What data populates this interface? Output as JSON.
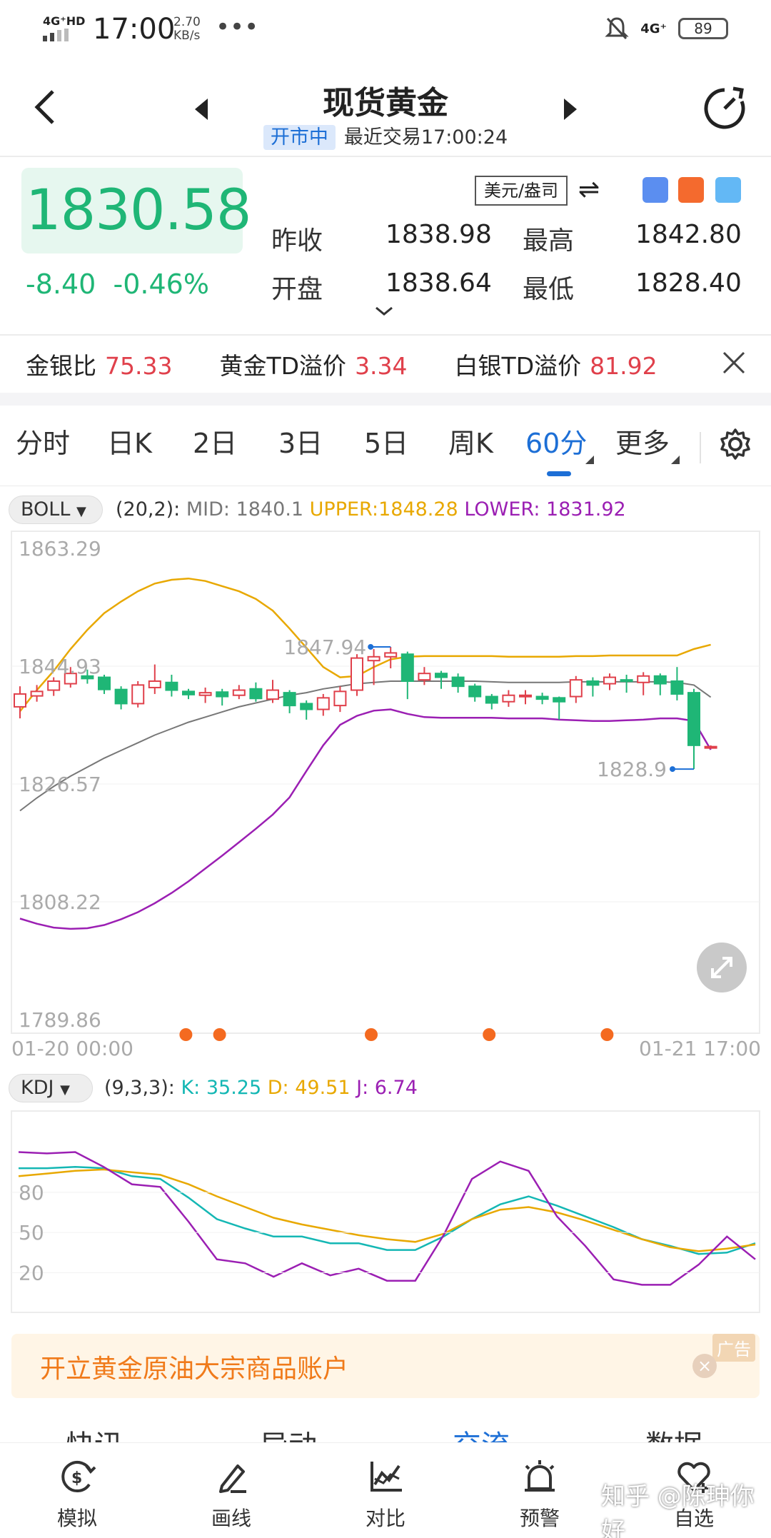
{
  "status_bar": {
    "network": "4G⁺HD",
    "time": "17:00",
    "speed": "2.70",
    "speed_unit": "KB/s",
    "more": "•••",
    "net_right": "4G⁺",
    "battery": "89"
  },
  "header": {
    "title": "现货黄金",
    "market_status": "开市中",
    "last_trade": "最近交易17:00:24"
  },
  "quote": {
    "price": "1830.58",
    "change": "-8.40",
    "change_pct": "-0.46%",
    "unit": "美元/盎司",
    "prev_close_label": "昨收",
    "prev_close": "1838.98",
    "high_label": "最高",
    "high": "1842.80",
    "open_label": "开盘",
    "open": "1838.64",
    "low_label": "最低",
    "low": "1828.40"
  },
  "ratios": [
    {
      "label": "金银比",
      "value": "75.33"
    },
    {
      "label": "黄金TD溢价",
      "value": "3.34"
    },
    {
      "label": "白银TD溢价",
      "value": "81.92"
    }
  ],
  "tabs": [
    "分时",
    "日K",
    "2日",
    "3日",
    "5日",
    "周K",
    "60分",
    "更多"
  ],
  "active_tab": "60分",
  "boll": {
    "name": "BOLL",
    "params": "(20,2):",
    "mid": "MID: 1840.1",
    "upper": "UPPER:1848.28",
    "lower": "LOWER: 1831.92"
  },
  "kdj": {
    "name": "KDJ",
    "params": "(9,3,3):",
    "k": "K: 35.25",
    "d": "D: 49.51",
    "j": "J: 6.74"
  },
  "colors": {
    "up": "#e0404b",
    "down": "#1fb676",
    "accent": "#1d6fd6",
    "upper": "#e8a800",
    "lower": "#9b1fb3",
    "mid": "#777777",
    "k": "#14b7b4"
  },
  "chart_data": [
    {
      "type": "candlestick",
      "title": "",
      "y_ticks": [
        "1863.29",
        "1844.93",
        "1826.57",
        "1808.22",
        "1789.86"
      ],
      "ylim": [
        1789.86,
        1863.29
      ],
      "x_start": "01-20 00:00",
      "x_end": "01-21 17:00",
      "max_marker": "1847.94",
      "min_marker": "1828.9",
      "candles": [
        {
          "o": 1838.6,
          "c": 1840.6,
          "h": 1841.8,
          "l": 1836.8
        },
        {
          "o": 1840.3,
          "c": 1841.0,
          "h": 1842.0,
          "l": 1839.4
        },
        {
          "o": 1841.2,
          "c": 1842.6,
          "h": 1843.2,
          "l": 1840.3
        },
        {
          "o": 1842.2,
          "c": 1843.8,
          "h": 1844.8,
          "l": 1841.6
        },
        {
          "o": 1843.4,
          "c": 1843.0,
          "h": 1844.4,
          "l": 1842.2
        },
        {
          "o": 1843.2,
          "c": 1841.3,
          "h": 1843.6,
          "l": 1840.6
        },
        {
          "o": 1841.3,
          "c": 1839.1,
          "h": 1841.8,
          "l": 1838.2
        },
        {
          "o": 1839.1,
          "c": 1842.0,
          "h": 1842.6,
          "l": 1838.5
        },
        {
          "o": 1841.6,
          "c": 1842.6,
          "h": 1845.2,
          "l": 1840.6
        },
        {
          "o": 1842.4,
          "c": 1841.2,
          "h": 1843.6,
          "l": 1840.2
        },
        {
          "o": 1841.0,
          "c": 1840.5,
          "h": 1841.4,
          "l": 1839.8
        },
        {
          "o": 1840.4,
          "c": 1840.8,
          "h": 1841.6,
          "l": 1839.2
        },
        {
          "o": 1840.9,
          "c": 1840.2,
          "h": 1841.4,
          "l": 1838.8
        },
        {
          "o": 1840.4,
          "c": 1841.2,
          "h": 1842.0,
          "l": 1839.8
        },
        {
          "o": 1841.4,
          "c": 1839.9,
          "h": 1842.4,
          "l": 1839.4
        },
        {
          "o": 1839.8,
          "c": 1841.2,
          "h": 1842.8,
          "l": 1839.2
        },
        {
          "o": 1840.8,
          "c": 1838.8,
          "h": 1841.2,
          "l": 1837.6
        },
        {
          "o": 1839.1,
          "c": 1838.2,
          "h": 1839.6,
          "l": 1836.6
        },
        {
          "o": 1838.2,
          "c": 1840.0,
          "h": 1840.6,
          "l": 1837.2
        },
        {
          "o": 1838.8,
          "c": 1841.0,
          "h": 1841.8,
          "l": 1837.8
        },
        {
          "o": 1841.2,
          "c": 1846.2,
          "h": 1846.8,
          "l": 1840.3
        },
        {
          "o": 1845.8,
          "c": 1846.4,
          "h": 1847.6,
          "l": 1842.0
        },
        {
          "o": 1846.4,
          "c": 1847.0,
          "h": 1847.94,
          "l": 1844.6
        },
        {
          "o": 1846.8,
          "c": 1842.6,
          "h": 1847.2,
          "l": 1839.8
        },
        {
          "o": 1842.8,
          "c": 1843.8,
          "h": 1844.8,
          "l": 1842.0
        },
        {
          "o": 1843.8,
          "c": 1843.2,
          "h": 1844.2,
          "l": 1841.4
        },
        {
          "o": 1843.2,
          "c": 1841.8,
          "h": 1843.8,
          "l": 1840.8
        },
        {
          "o": 1841.8,
          "c": 1840.2,
          "h": 1842.2,
          "l": 1839.4
        },
        {
          "o": 1840.2,
          "c": 1839.2,
          "h": 1840.6,
          "l": 1838.2
        },
        {
          "o": 1839.4,
          "c": 1840.4,
          "h": 1841.2,
          "l": 1838.6
        },
        {
          "o": 1840.2,
          "c": 1840.4,
          "h": 1841.2,
          "l": 1839.0
        },
        {
          "o": 1840.2,
          "c": 1839.8,
          "h": 1840.8,
          "l": 1839.0
        },
        {
          "o": 1840.0,
          "c": 1839.4,
          "h": 1840.2,
          "l": 1836.6
        },
        {
          "o": 1840.2,
          "c": 1842.8,
          "h": 1843.4,
          "l": 1839.2
        },
        {
          "o": 1842.6,
          "c": 1842.0,
          "h": 1843.2,
          "l": 1840.2
        },
        {
          "o": 1842.2,
          "c": 1843.2,
          "h": 1843.8,
          "l": 1841.2
        },
        {
          "o": 1842.8,
          "c": 1842.6,
          "h": 1843.6,
          "l": 1840.8
        },
        {
          "o": 1842.4,
          "c": 1843.4,
          "h": 1844.0,
          "l": 1840.4
        },
        {
          "o": 1843.4,
          "c": 1842.2,
          "h": 1843.8,
          "l": 1840.4
        },
        {
          "o": 1842.6,
          "c": 1840.6,
          "h": 1844.8,
          "l": 1839.6
        },
        {
          "o": 1840.8,
          "c": 1832.6,
          "h": 1841.4,
          "l": 1828.9
        },
        {
          "o": 1832.4,
          "c": 1832.4,
          "h": 1832.6,
          "l": 1832.2
        }
      ],
      "upper": [
        1837.9,
        1841.2,
        1844.2,
        1847.6,
        1850.6,
        1853.2,
        1855.0,
        1856.6,
        1857.8,
        1858.4,
        1858.6,
        1858.2,
        1857.4,
        1856.6,
        1855.4,
        1853.6,
        1850.8,
        1847.8,
        1844.8,
        1843.2,
        1843.4,
        1844.8,
        1846.0,
        1846.4,
        1846.5,
        1846.5,
        1846.5,
        1846.5,
        1846.5,
        1846.4,
        1846.4,
        1846.4,
        1846.4,
        1846.5,
        1846.5,
        1846.6,
        1846.6,
        1846.6,
        1846.6,
        1846.6,
        1847.6,
        1848.28
      ],
      "mid": [
        1822.4,
        1824.4,
        1826.2,
        1827.8,
        1829.2,
        1830.6,
        1831.8,
        1833.0,
        1834.2,
        1835.2,
        1836.2,
        1837.0,
        1837.8,
        1838.6,
        1839.2,
        1839.8,
        1840.4,
        1840.8,
        1841.4,
        1841.8,
        1842.2,
        1842.4,
        1842.6,
        1842.6,
        1842.6,
        1842.6,
        1842.6,
        1842.6,
        1842.5,
        1842.4,
        1842.4,
        1842.4,
        1842.4,
        1842.5,
        1842.5,
        1842.5,
        1842.5,
        1842.5,
        1842.5,
        1842.4,
        1842.0,
        1840.1
      ],
      "lower": [
        1805.6,
        1804.8,
        1804.2,
        1804.0,
        1804.1,
        1804.6,
        1805.5,
        1806.6,
        1808.0,
        1809.6,
        1811.4,
        1813.4,
        1815.4,
        1817.5,
        1819.6,
        1821.8,
        1824.5,
        1828.6,
        1832.6,
        1835.8,
        1837.2,
        1838.0,
        1838.2,
        1837.5,
        1837.0,
        1836.9,
        1836.9,
        1836.9,
        1836.9,
        1836.8,
        1836.8,
        1836.8,
        1836.6,
        1836.5,
        1836.4,
        1836.4,
        1836.5,
        1836.6,
        1836.8,
        1836.8,
        1836.4,
        1831.92
      ],
      "event_dot_index": [
        9,
        11,
        20,
        27,
        34
      ]
    },
    {
      "type": "line",
      "title": "",
      "y_ticks": [
        "80",
        "50",
        "20"
      ],
      "ylim": [
        0,
        130
      ],
      "series": [
        {
          "name": "K",
          "values": [
            98,
            98,
            99,
            98,
            92,
            90,
            76,
            60,
            53,
            47,
            47,
            42,
            42,
            37,
            37,
            47,
            60,
            71,
            77,
            70,
            62,
            54,
            45,
            40,
            34,
            35,
            42
          ]
        },
        {
          "name": "D",
          "values": [
            92,
            94,
            96,
            97,
            95,
            93,
            86,
            77,
            69,
            61,
            56,
            52,
            48,
            45,
            43,
            49,
            60,
            67,
            69,
            65,
            59,
            52,
            45,
            39,
            36,
            38,
            41
          ]
        },
        {
          "name": "J",
          "values": [
            110,
            109,
            110,
            99,
            86,
            84,
            58,
            30,
            27,
            17,
            27,
            18,
            23,
            14,
            14,
            48,
            90,
            103,
            96,
            62,
            40,
            15,
            11,
            11,
            26,
            47,
            30
          ]
        }
      ]
    }
  ],
  "ad": {
    "text": "开立黄金原油大宗商品账户",
    "tag": "广告",
    "close": "×"
  },
  "news_tabs": [
    "快讯",
    "异动",
    "交流",
    "数据"
  ],
  "active_news_tab": "交流",
  "bottom_nav": [
    {
      "label": "模拟",
      "icon": "simulate-icon"
    },
    {
      "label": "画线",
      "icon": "draw-icon"
    },
    {
      "label": "对比",
      "icon": "compare-icon"
    },
    {
      "label": "预警",
      "icon": "alert-icon"
    },
    {
      "label": "自选",
      "icon": "favorite-icon"
    }
  ],
  "watermark": "知乎 @陈珅你好"
}
